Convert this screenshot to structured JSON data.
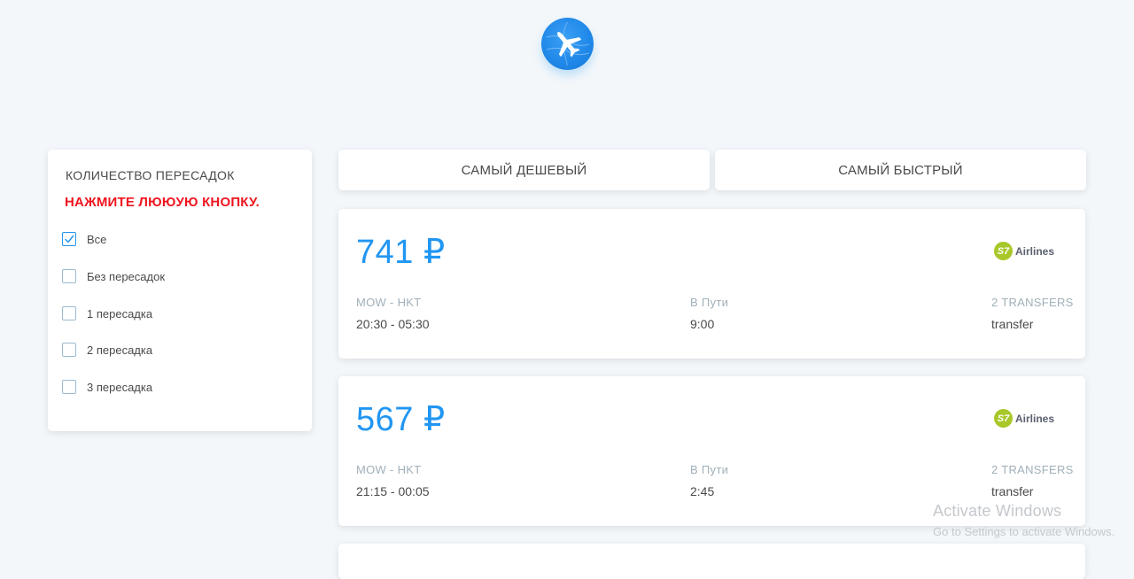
{
  "header": {
    "logo_icon": "airplane-icon"
  },
  "filters": {
    "title": "КОЛИЧЕСТВО ПЕРЕСАДОК",
    "warning": "НАЖМИТЕ ЛЮЮУЮ КНОПКУ.",
    "options": [
      {
        "label": "Все",
        "checked": true
      },
      {
        "label": "Без пересадок",
        "checked": false
      },
      {
        "label": "1 пересадка",
        "checked": false
      },
      {
        "label": "2 пересадка",
        "checked": false
      },
      {
        "label": "3 пересадка",
        "checked": false
      }
    ]
  },
  "tabs": {
    "cheapest": "САМЫЙ ДЕШЕВЫЙ",
    "fastest": "САМЫЙ БЫСТРЫЙ"
  },
  "tickets": [
    {
      "price": "741 ₽",
      "airline_badge": "S7",
      "airline_name": "Airlines",
      "route": "MOW - HKT",
      "time": "20:30 - 05:30",
      "duration_label": "В Пути",
      "duration": "9:00",
      "stops_label": "2 TRANSFERS",
      "stops": "transfer"
    },
    {
      "price": "567 ₽",
      "airline_badge": "S7",
      "airline_name": "Airlines",
      "route": "MOW - HKT",
      "time": "21:15 - 00:05",
      "duration_label": "В Пути",
      "duration": "2:45",
      "stops_label": "2 TRANSFERS",
      "stops": "transfer"
    }
  ],
  "watermark": {
    "title": "Activate Windows",
    "subtitle": "Go to Settings to activate Windows."
  },
  "colors": {
    "accent": "#2196f3",
    "warning": "#f0141e",
    "background": "#f3f7fa",
    "airline_green": "#a8c728"
  }
}
